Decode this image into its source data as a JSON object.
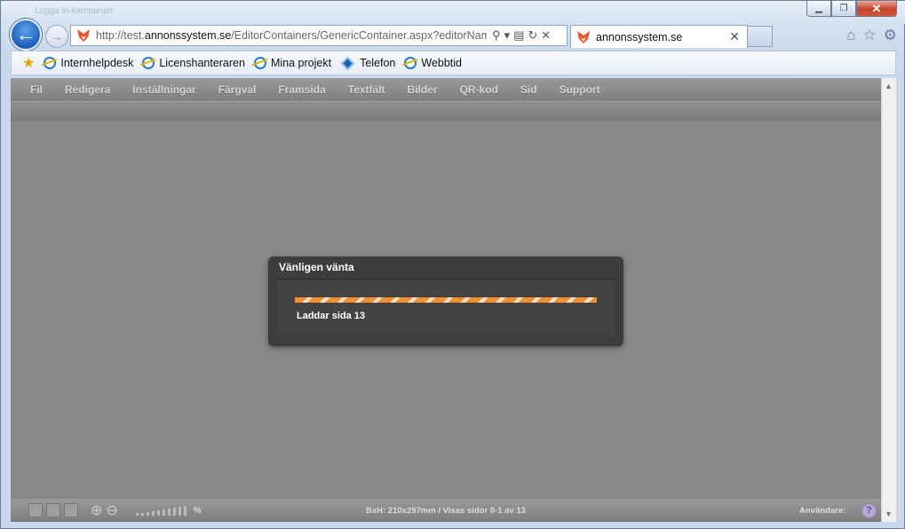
{
  "browser": {
    "address_url_prefix": "http://test.",
    "address_url_host": "annonssystem.se",
    "address_url_path": "/EditorContainers/GenericContainer.aspx?editorName=p",
    "tab_title": "annonssystem.se",
    "ghost_tab_text": "Logga in-kampanjer"
  },
  "favorites": [
    {
      "label": "Internhelpdesk",
      "icon": "ie-icon"
    },
    {
      "label": "Licenshanteraren",
      "icon": "ie-icon"
    },
    {
      "label": "Mina projekt",
      "icon": "ie-icon"
    },
    {
      "label": "Telefon",
      "icon": "diamond-icon"
    },
    {
      "label": "Webbtid",
      "icon": "ie-icon"
    }
  ],
  "menu": [
    "Fil",
    "Redigera",
    "Inställningar",
    "Färgval",
    "Framsida",
    "Textfält",
    "Bilder",
    "QR-kod",
    "Sid",
    "Support"
  ],
  "modal": {
    "title": "Vänligen vänta",
    "message": "Laddar sida 13"
  },
  "status": {
    "percent_label": "%",
    "info": "BxH: 210x297mm  /  Visas sidor 0-1 av 13",
    "user_label": "Användare:",
    "help": "?"
  }
}
